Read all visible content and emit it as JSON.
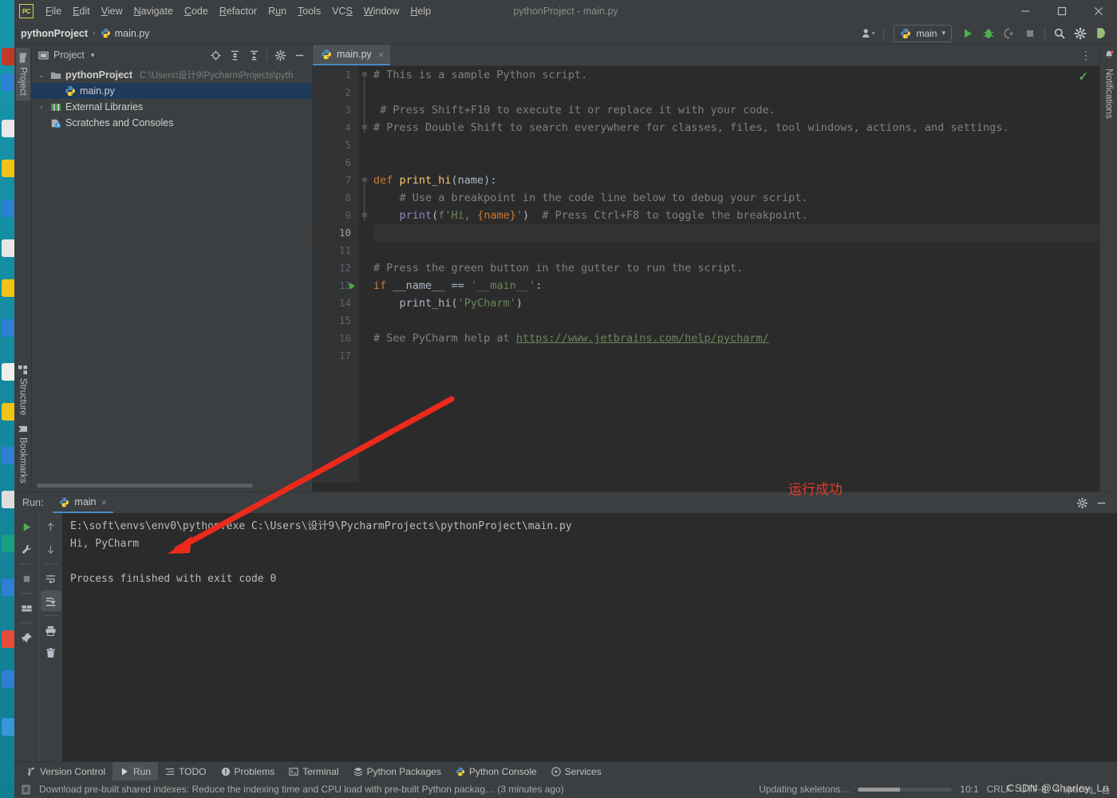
{
  "window": {
    "title": "pythonProject - main.py",
    "logo_text": "PC",
    "controls": {
      "minimize": "minimize-icon",
      "maximize": "maximize-icon",
      "close": "close-icon"
    }
  },
  "menu": {
    "items": [
      {
        "label": "File",
        "mnemonic": "F"
      },
      {
        "label": "Edit",
        "mnemonic": "E"
      },
      {
        "label": "View",
        "mnemonic": "V"
      },
      {
        "label": "Navigate",
        "mnemonic": "N"
      },
      {
        "label": "Code",
        "mnemonic": "C"
      },
      {
        "label": "Refactor",
        "mnemonic": "R"
      },
      {
        "label": "Run",
        "mnemonic": "u"
      },
      {
        "label": "Tools",
        "mnemonic": "T"
      },
      {
        "label": "VCS",
        "mnemonic": "S"
      },
      {
        "label": "Window",
        "mnemonic": "W"
      },
      {
        "label": "Help",
        "mnemonic": "H"
      }
    ]
  },
  "navbar": {
    "breadcrumb": [
      {
        "label": "pythonProject",
        "bold": true
      },
      {
        "label": "main.py",
        "bold": false
      }
    ],
    "separator": "›",
    "run_config": {
      "label": "main",
      "icon": "python-icon",
      "chevron": "▾"
    },
    "actions": [
      {
        "name": "user-account-icon",
        "label": ""
      },
      {
        "name": "run-button",
        "label": ""
      },
      {
        "name": "debug-button",
        "label": ""
      },
      {
        "name": "run-coverage-button",
        "label": ""
      },
      {
        "name": "stop-button",
        "label": ""
      },
      {
        "name": "search-everywhere-icon",
        "label": ""
      },
      {
        "name": "settings-gear-icon",
        "label": ""
      },
      {
        "name": "ide-assistant-icon",
        "label": ""
      }
    ]
  },
  "left_stripe": {
    "top": [
      {
        "label": "Project",
        "active": true,
        "icon": "folder-icon"
      }
    ],
    "bottom": [
      {
        "label": "Structure",
        "active": false,
        "icon": "structure-icon"
      },
      {
        "label": "Bookmarks",
        "active": false,
        "icon": "bookmark-icon"
      }
    ]
  },
  "right_stripe": {
    "items": [
      {
        "label": "Notifications",
        "icon": "bell-icon"
      }
    ]
  },
  "project_panel": {
    "title": "Project",
    "chevron": "▾",
    "toolbar": [
      {
        "name": "select-opened-file-icon"
      },
      {
        "name": "expand-all-icon"
      },
      {
        "name": "collapse-all-icon"
      },
      {
        "name": "project-settings-gear-icon"
      },
      {
        "name": "hide-panel-icon"
      }
    ],
    "tree": [
      {
        "indent": 0,
        "arrow": "⌄",
        "icon": "folder-icon",
        "label": "pythonProject",
        "bold": true,
        "path": "C:\\Users\\设计9\\PycharmProjects\\pyth",
        "selected": false
      },
      {
        "indent": 1,
        "arrow": "",
        "icon": "python-file-icon",
        "label": "main.py",
        "bold": false,
        "path": "",
        "selected": true
      },
      {
        "indent": 0,
        "arrow": "›",
        "icon": "libraries-icon",
        "label": "External Libraries",
        "bold": false,
        "path": "",
        "selected": false
      },
      {
        "indent": 0,
        "arrow": "",
        "icon": "scratches-icon",
        "label": "Scratches and Consoles",
        "bold": false,
        "path": "",
        "selected": false
      }
    ]
  },
  "editor": {
    "tabs": [
      {
        "label": "main.py",
        "icon": "python-file-icon",
        "close": "×",
        "active": true
      }
    ],
    "options_icon": "⋮",
    "inspection_status": "✓",
    "current_line": 10,
    "lines": [
      {
        "n": 1,
        "fold": "⊟",
        "gutter": "",
        "tokens": [
          {
            "t": "# This is a sample Python script.",
            "c": "c-comment"
          }
        ]
      },
      {
        "n": 2,
        "fold": "",
        "gutter": "",
        "tokens": []
      },
      {
        "n": 3,
        "fold": "",
        "gutter": "",
        "tokens": [
          {
            "t": " # Press Shift+F10 to execute it or replace it with your code.",
            "c": "c-comment"
          }
        ]
      },
      {
        "n": 4,
        "fold": "⊟",
        "gutter": "",
        "tokens": [
          {
            "t": "# Press Double Shift to search everywhere for classes, files, tool windows, actions, and settings.",
            "c": "c-comment"
          }
        ]
      },
      {
        "n": 5,
        "fold": "",
        "gutter": "",
        "tokens": []
      },
      {
        "n": 6,
        "fold": "",
        "gutter": "",
        "tokens": []
      },
      {
        "n": 7,
        "fold": "⊟",
        "gutter": "",
        "tokens": [
          {
            "t": "def ",
            "c": "c-kw"
          },
          {
            "t": "print_hi",
            "c": "c-fn"
          },
          {
            "t": "(name):",
            "c": "c-name"
          }
        ]
      },
      {
        "n": 8,
        "fold": "",
        "gutter": "",
        "tokens": [
          {
            "t": "    # Use a breakpoint in the code line below to debug your script.",
            "c": "c-comment"
          }
        ]
      },
      {
        "n": 9,
        "fold": "⊟",
        "gutter": "",
        "tokens": [
          {
            "t": "    ",
            "c": "c-name"
          },
          {
            "t": "print",
            "c": "c-builtin"
          },
          {
            "t": "(",
            "c": "c-name"
          },
          {
            "t": "f'Hi, ",
            "c": "c-str"
          },
          {
            "t": "{name}",
            "c": "c-fstr-br"
          },
          {
            "t": "'",
            "c": "c-str"
          },
          {
            "t": ")",
            "c": "c-name"
          },
          {
            "t": "  # Press Ctrl+F8 to toggle the breakpoint.",
            "c": "c-comment"
          }
        ]
      },
      {
        "n": 10,
        "fold": "",
        "gutter": "",
        "tokens": []
      },
      {
        "n": 11,
        "fold": "",
        "gutter": "",
        "tokens": []
      },
      {
        "n": 12,
        "fold": "",
        "gutter": "",
        "tokens": [
          {
            "t": "# Press the green button in the gutter to run the script.",
            "c": "c-comment"
          }
        ]
      },
      {
        "n": 13,
        "fold": "",
        "gutter": "run-gutter-icon",
        "tokens": [
          {
            "t": "if ",
            "c": "c-kw"
          },
          {
            "t": "__name__ ",
            "c": "c-name"
          },
          {
            "t": "== ",
            "c": "c-name"
          },
          {
            "t": "'__main__'",
            "c": "c-str"
          },
          {
            "t": ":",
            "c": "c-name"
          }
        ]
      },
      {
        "n": 14,
        "fold": "",
        "gutter": "",
        "tokens": [
          {
            "t": "    print_hi(",
            "c": "c-name"
          },
          {
            "t": "'PyCharm'",
            "c": "c-str"
          },
          {
            "t": ")",
            "c": "c-name"
          }
        ]
      },
      {
        "n": 15,
        "fold": "",
        "gutter": "",
        "tokens": []
      },
      {
        "n": 16,
        "fold": "",
        "gutter": "",
        "tokens": [
          {
            "t": "# See PyCharm help at ",
            "c": "c-comment"
          },
          {
            "t": "https://www.jetbrains.com/help/pycharm/",
            "c": "c-link"
          }
        ]
      },
      {
        "n": 17,
        "fold": "",
        "gutter": "",
        "tokens": []
      }
    ]
  },
  "annotation": {
    "text": "运行成功",
    "color": "#e83b2a"
  },
  "run_panel": {
    "label": "Run:",
    "tab": {
      "label": "main",
      "icon": "python-icon",
      "close": "×"
    },
    "header_actions": [
      {
        "name": "run-settings-gear-icon"
      },
      {
        "name": "hide-run-panel-icon"
      }
    ],
    "toolbar_left": [
      {
        "name": "rerun-button"
      },
      {
        "name": "modify-run-configuration-button"
      },
      {
        "name": "stop-process-button"
      },
      {
        "name": "layout-settings-button"
      },
      {
        "name": "pin-tab-button"
      }
    ],
    "toolbar_right": [
      {
        "name": "up-the-stack-trace-button"
      },
      {
        "name": "down-the-stack-trace-button"
      },
      {
        "name": "soft-wrap-button"
      },
      {
        "name": "scroll-to-end-button",
        "active": true
      },
      {
        "name": "print-button"
      },
      {
        "name": "clear-all-button"
      }
    ],
    "console": [
      "E:\\soft\\envs\\env0\\python.exe C:\\Users\\设计9\\PycharmProjects\\pythonProject\\main.py",
      "Hi, PyCharm",
      "",
      "Process finished with exit code 0"
    ]
  },
  "bottom_bar": {
    "tabs": [
      {
        "label": "Version Control",
        "icon": "vcs-icon",
        "active": false
      },
      {
        "label": "Run",
        "icon": "run-icon",
        "active": true
      },
      {
        "label": "TODO",
        "icon": "todo-icon",
        "active": false
      },
      {
        "label": "Problems",
        "icon": "problems-icon",
        "active": false
      },
      {
        "label": "Terminal",
        "icon": "terminal-icon",
        "active": false
      },
      {
        "label": "Python Packages",
        "icon": "packages-icon",
        "active": false
      },
      {
        "label": "Python Console",
        "icon": "python-console-icon",
        "active": false
      },
      {
        "label": "Services",
        "icon": "services-icon",
        "active": false
      }
    ]
  },
  "status_bar": {
    "message": "Download pre-built shared indexes: Reduce the indexing time and CPU load with pre-built Python packag… (3 minutes ago)",
    "message_icon": "notification-icon",
    "background_task": "Updating skeletons…",
    "progress_percent": 45,
    "caret_position": "10:1",
    "line_separator": "CRLF",
    "encoding": "UTF-8",
    "indent": "4 spaces",
    "lock_icon": "lock-icon",
    "watermark": "CSDN @Charley_Lu"
  }
}
